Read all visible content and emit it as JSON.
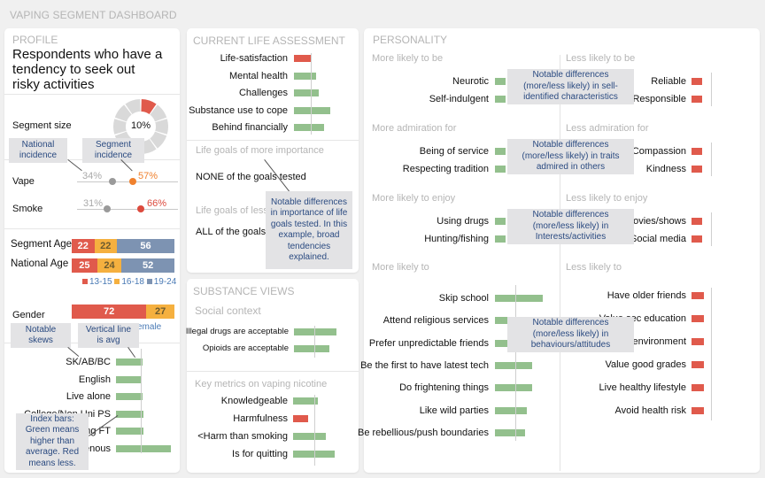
{
  "dashboard_title": "VAPING SEGMENT DASHBOARD",
  "colors": {
    "more": "#93c08d",
    "less": "#e05a4c",
    "orange": "#f29a3a",
    "yellow": "#f5b03f",
    "blue_grey": "#7d93b2",
    "callout_bg": "#e3e3e5",
    "callout_text": "#2a4a80"
  },
  "profile": {
    "section_title": "PROFILE",
    "headline": "Respondents who have a tendency to seek out risky activities",
    "segment_size": {
      "label": "Segment size",
      "value": "10%",
      "fraction": 0.1,
      "segments": 10,
      "highlighted": 1
    },
    "callouts": {
      "national": "National incidence",
      "segment": "Segment incidence"
    },
    "incidence": [
      {
        "label": "Vape",
        "national": "34%",
        "segment": "57%",
        "national_value": 34,
        "segment_value": 57,
        "segment_color": "#f0812e"
      },
      {
        "label": "Smoke",
        "national": "31%",
        "segment": "66%",
        "national_value": 31,
        "segment_value": 66,
        "segment_color": "#dc4a3d"
      }
    ],
    "age": {
      "rows": [
        {
          "label": "Segment Age",
          "values": [
            22,
            22,
            56
          ]
        },
        {
          "label": "National Age",
          "values": [
            25,
            24,
            52
          ]
        }
      ],
      "legend": [
        "13-15",
        "16-18",
        "19-24"
      ]
    },
    "gender": {
      "label": "Gender",
      "values": [
        72,
        27
      ],
      "legend_visible": "emale"
    },
    "skews_callout": "Notable skews",
    "avg_callout": "Vertical line is avg",
    "index_callout": "Index bars: Green means higher than average. Red means less.",
    "skews": [
      {
        "label": "SK/AB/BC",
        "index": 1.25,
        "dir": "more"
      },
      {
        "label": "English",
        "index": 1.15,
        "dir": "more"
      },
      {
        "label": "Live alone",
        "index": 1.25,
        "dir": "more"
      },
      {
        "label": "College/Non Uni PS",
        "index": 1.3,
        "dir": "more"
      },
      {
        "label": "Working FT",
        "index": 1.3,
        "dir": "more"
      },
      {
        "label": "Indigenous",
        "index": 2.6,
        "dir": "more"
      }
    ]
  },
  "life": {
    "section_title": "CURRENT LIFE ASSESSMENT",
    "items": [
      {
        "label": "Life-satisfaction",
        "index": 0.85,
        "dir": "less"
      },
      {
        "label": "Mental health",
        "index": 1.05,
        "dir": "more"
      },
      {
        "label": "Challenges",
        "index": 1.15,
        "dir": "more"
      },
      {
        "label": "Substance use to cope",
        "index": 1.7,
        "dir": "more"
      },
      {
        "label": "Behind financially",
        "index": 1.4,
        "dir": "more"
      }
    ],
    "goals_more_title": "Life goals of more importance",
    "goals_more_text": "NONE of the goals tested",
    "goals_less_title": "Life goals of less importance",
    "goals_less_text": "ALL of the goals tested",
    "goals_callout": "Notable differences in importance of life goals tested. In this example, broad tendencies explained."
  },
  "substance": {
    "section_title": "SUBSTANCE VIEWS",
    "social_title": "Social context",
    "social": [
      {
        "label": "Illegal drugs are acceptable",
        "index": 2.0,
        "dir": "more"
      },
      {
        "label": "Opioids are acceptable",
        "index": 1.65,
        "dir": "more"
      }
    ],
    "metrics_title": "Key metrics on vaping nicotine",
    "metrics": [
      {
        "label": "Knowledgeable",
        "index": 1.15,
        "dir": "more"
      },
      {
        "label": "Harmfulness",
        "index": 0.7,
        "dir": "less"
      },
      {
        "label": "<Harm than smoking",
        "index": 1.55,
        "dir": "more"
      },
      {
        "label": "Is for quitting",
        "index": 1.95,
        "dir": "more"
      }
    ]
  },
  "personality": {
    "section_title": "PERSONALITY",
    "groups": [
      {
        "more_title": "More likely to be",
        "less_title": "Less likely to be",
        "more": [
          "Neurotic",
          "Self-indulgent"
        ],
        "less": [
          "Reliable",
          "Responsible"
        ],
        "callout": "Notable differences (more/less likely) in sell-identified characteristics"
      },
      {
        "more_title": "More admiration for",
        "less_title": "Less admiration for",
        "more": [
          "Being of service",
          "Respecting tradition"
        ],
        "less": [
          "Compassion",
          "Kindness"
        ],
        "callout": "Notable differences (more/less likely) in traits admired in others"
      },
      {
        "more_title": "More likely to enjoy",
        "less_title": "Less likely to enjoy",
        "more": [
          "Using drugs",
          "Hunting/fishing"
        ],
        "less": [
          "Movies/shows",
          "Social media"
        ],
        "callout": "Notable differences (more/less likely) in Interests/activities"
      }
    ],
    "likely_to": {
      "more_title": "More likely to",
      "less_title": "Less likely to",
      "more": [
        {
          "label": "Skip school",
          "index": 2.3
        },
        {
          "label": "Attend religious services",
          "index": 1.1
        },
        {
          "label": "Prefer unpredictable friends",
          "index": 1.1
        },
        {
          "label": "Be the first to have latest tech",
          "index": 1.8
        },
        {
          "label": "Do frightening things",
          "index": 1.8
        },
        {
          "label": "Like wild parties",
          "index": 1.55
        },
        {
          "label": "Be rebellious/push boundaries",
          "index": 1.45
        }
      ],
      "less": [
        "Have older friends",
        "Value sec education",
        "Care for environment",
        "Value good grades",
        "Live healthy lifestyle",
        "Avoid health risk"
      ],
      "callout": "Notable differences (more/less likely) in behaviours/attitudes"
    }
  }
}
